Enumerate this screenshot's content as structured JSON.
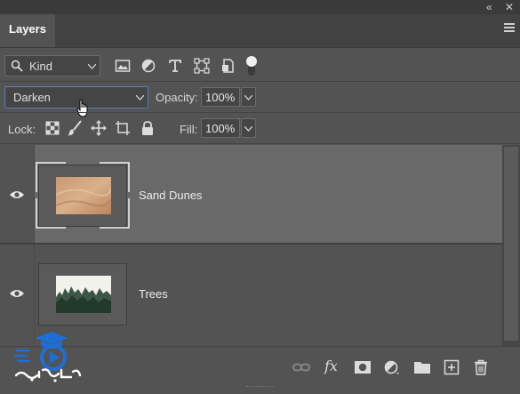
{
  "window": {
    "collapse_glyph": "«",
    "close_glyph": "✕"
  },
  "panel": {
    "tab_label": "Layers",
    "menu_icon": "panel-menu-icon"
  },
  "filter": {
    "kind_label": "Kind",
    "icons": [
      "pixel-layer-filter-icon",
      "adjustment-layer-filter-icon",
      "type-layer-filter-icon",
      "shape-layer-filter-icon",
      "smart-object-filter-icon"
    ]
  },
  "blend": {
    "mode": "Darken",
    "opacity_label": "Opacity:",
    "opacity_value": "100%"
  },
  "lock": {
    "label": "Lock:",
    "icons": [
      "lock-transparent-pixels-icon",
      "lock-image-pixels-icon",
      "lock-position-icon",
      "lock-artboard-icon",
      "lock-all-icon"
    ],
    "fill_label": "Fill:",
    "fill_value": "100%"
  },
  "layers": [
    {
      "name": "Sand Dunes",
      "visible": true,
      "selected": true
    },
    {
      "name": "Trees",
      "visible": true,
      "selected": false
    }
  ],
  "bottom_toolbar": {
    "fx_label": "fx",
    "icons": [
      "link-layers-icon",
      "layer-style-icon",
      "add-mask-icon",
      "adjustment-layer-icon",
      "new-group-icon",
      "new-layer-icon",
      "delete-layer-icon"
    ]
  },
  "colors": {
    "panel_bg": "#535353",
    "selected_row": "#696969",
    "focus_border": "#5c7fb3"
  }
}
